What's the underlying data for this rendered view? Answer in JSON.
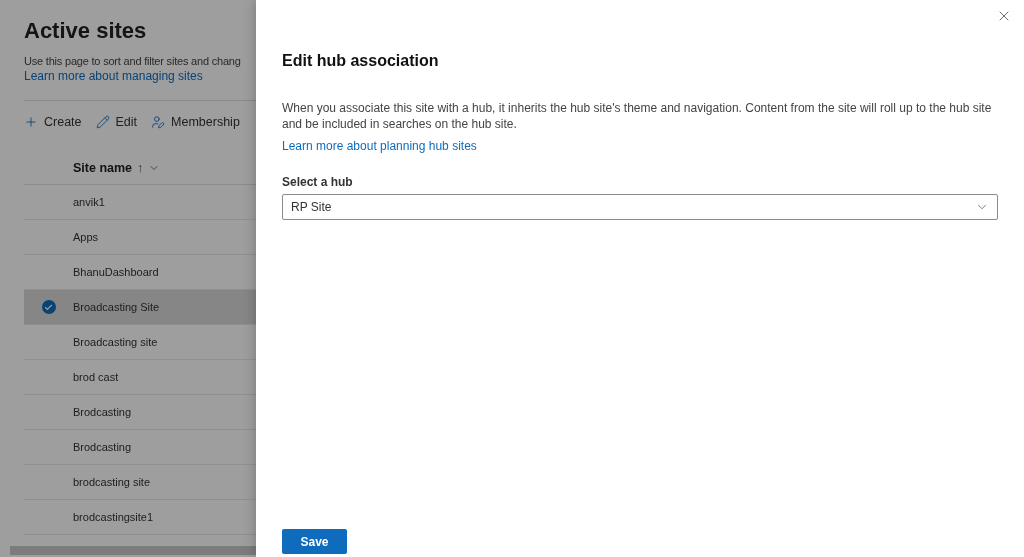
{
  "page": {
    "title": "Active sites",
    "description": "Use this page to sort and filter sites and chang",
    "link": "Learn more about managing sites"
  },
  "toolbar": [
    {
      "label": "Create"
    },
    {
      "label": "Edit"
    },
    {
      "label": "Membership"
    }
  ],
  "table": {
    "columns": [
      {
        "label": "Site name",
        "sort_icon": "↑"
      }
    ],
    "rows": [
      {
        "name": "anvik1",
        "selected": false
      },
      {
        "name": "Apps",
        "selected": false
      },
      {
        "name": "BhanuDashboard",
        "selected": false
      },
      {
        "name": "Broadcasting Site",
        "selected": true
      },
      {
        "name": "Broadcasting site",
        "selected": false
      },
      {
        "name": "brod cast",
        "selected": false
      },
      {
        "name": "Brodcasting",
        "selected": false
      },
      {
        "name": "Brodcasting",
        "selected": false
      },
      {
        "name": "brodcasting site",
        "selected": false
      },
      {
        "name": "brodcastingsite1",
        "selected": false
      }
    ]
  },
  "panel": {
    "title": "Edit hub association",
    "description": "When you associate this site with a hub, it inherits the hub site's theme and navigation. Content from the site will roll up to the hub site and be included in searches on the hub site.",
    "link": "Learn more about planning hub sites",
    "field": {
      "label": "Select a hub",
      "value": "RP Site"
    },
    "buttons": [
      "Save"
    ]
  }
}
